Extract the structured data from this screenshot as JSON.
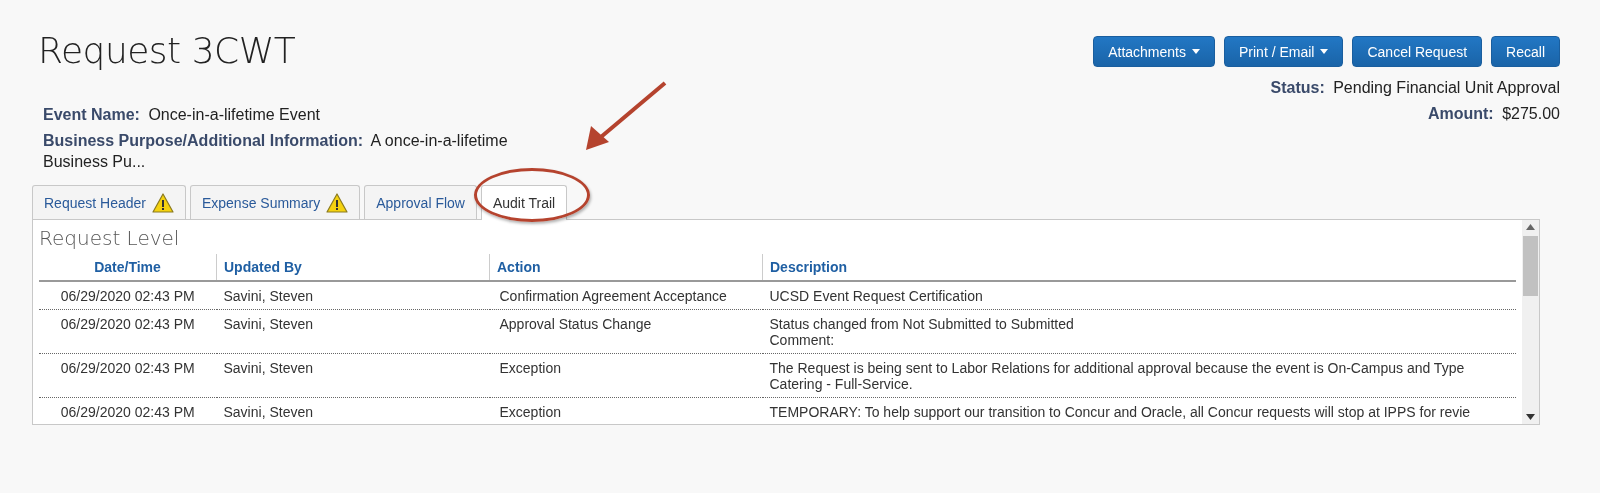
{
  "title": "Request 3CWT",
  "buttons": [
    {
      "label": "Attachments",
      "dropdown": true
    },
    {
      "label": "Print / Email",
      "dropdown": true
    },
    {
      "label": "Cancel Request",
      "dropdown": false
    },
    {
      "label": "Recall",
      "dropdown": false
    }
  ],
  "fields": [
    {
      "label": "Event Name:",
      "value": "Once-in-a-lifetime Event"
    },
    {
      "label": "Business Purpose/Additional Information:",
      "value": "A once-in-a-lifetime Business Pu..."
    }
  ],
  "summary": [
    {
      "label": "Status:",
      "value": "Pending Financial Unit Approval"
    },
    {
      "label": "Amount:",
      "value": "$275.00"
    }
  ],
  "tabs": [
    {
      "label": "Request Header",
      "warning": true,
      "selected": false
    },
    {
      "label": "Expense Summary",
      "warning": true,
      "selected": false
    },
    {
      "label": "Approval Flow",
      "warning": false,
      "selected": false
    },
    {
      "label": "Audit Trail",
      "warning": false,
      "selected": true
    }
  ],
  "section_title": "Request Level",
  "table": {
    "columns": [
      "Date/Time",
      "Updated By",
      "Action",
      "Description"
    ],
    "rows": [
      {
        "date_time": "06/29/2020 02:43 PM",
        "updated_by": "Savini, Steven",
        "action": "Confirmation Agreement Acceptance",
        "description": [
          "UCSD Event Request Certification"
        ]
      },
      {
        "date_time": "06/29/2020 02:43 PM",
        "updated_by": "Savini, Steven",
        "action": "Approval Status Change",
        "description": [
          "Status changed from Not Submitted to Submitted",
          "Comment:"
        ]
      },
      {
        "date_time": "06/29/2020 02:43 PM",
        "updated_by": "Savini, Steven",
        "action": "Exception",
        "description": [
          "The Request is being sent to Labor Relations for additional approval because the event is On-Campus and Type",
          "Catering - Full-Service."
        ]
      },
      {
        "date_time": "06/29/2020 02:43 PM",
        "updated_by": "Savini, Steven",
        "action": "Exception",
        "description": [
          "TEMPORARY: To help support our transition to Concur and Oracle, all Concur requests will stop at IPPS for revie"
        ]
      }
    ]
  }
}
